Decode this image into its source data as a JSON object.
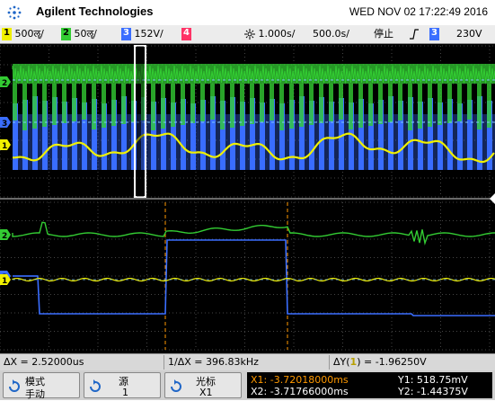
{
  "header": {
    "brand": "Agilent Technologies",
    "datetime": "WED NOV 02 17:22:49 2016"
  },
  "status": {
    "ch1": {
      "num": "1",
      "scale": "500ॡ/",
      "color": "#f0f000"
    },
    "ch2": {
      "num": "2",
      "scale": "50ॡ/",
      "color": "#33cc33"
    },
    "ch3": {
      "num": "3",
      "scale": "152V/",
      "color": "#3a6eff"
    },
    "ch4": {
      "num": "4",
      "color": "#ff3366"
    },
    "timebase": "1.000",
    "timebase_unit": "s/",
    "delay": "500.0",
    "delay_unit": "s/",
    "run_state": "停止",
    "trigger_channel": "3",
    "trigger_level": "230V"
  },
  "info": {
    "dx": "ΔX = 2.52000us",
    "inv_dx": "1/ΔX = 396.83kHz",
    "dy_prefix": "ΔY(",
    "dy_channel": "1",
    "dy_suffix": ") = -1.96250V"
  },
  "softkeys": {
    "mode": {
      "l1": "模式",
      "l2": "手动"
    },
    "source": {
      "l1": "源",
      "l2": "1"
    },
    "cursor": {
      "l1": "光标",
      "l2": "X1"
    },
    "x1": "X1: -3.72018000ms",
    "x2": "X2: -3.71766000ms",
    "y1": "Y1: 518.75mV",
    "y2": "Y2: -1.44375V"
  },
  "colors": {
    "ch1": "#f0f000",
    "ch2": "#33cc33",
    "ch3": "#3a6eff",
    "ch4": "#ff3366",
    "cursor_x1": "#ff9900"
  }
}
